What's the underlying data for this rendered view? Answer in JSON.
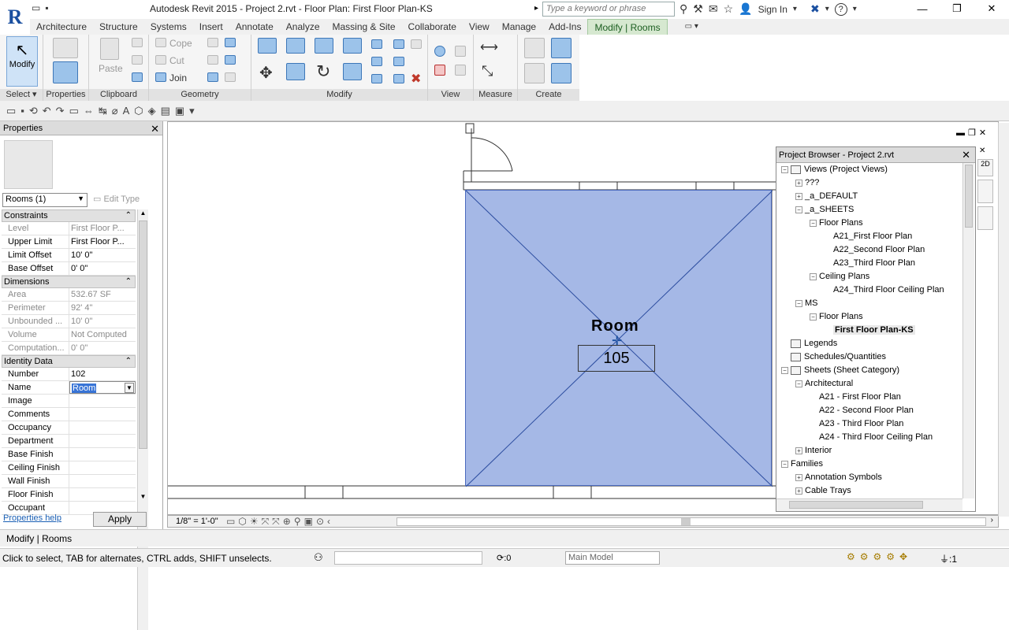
{
  "app": {
    "title": "Autodesk Revit 2015 -    Project 2.rvt - Floor Plan: First Floor Plan-KS",
    "logo_letter": "R",
    "search_placeholder": "Type a keyword or phrase",
    "sign_in": "Sign In"
  },
  "tabs": [
    {
      "label": "Architecture"
    },
    {
      "label": "Structure"
    },
    {
      "label": "Systems"
    },
    {
      "label": "Insert"
    },
    {
      "label": "Annotate"
    },
    {
      "label": "Analyze"
    },
    {
      "label": "Massing & Site"
    },
    {
      "label": "Collaborate"
    },
    {
      "label": "View"
    },
    {
      "label": "Manage"
    },
    {
      "label": "Add-Ins"
    },
    {
      "label": "Modify | Rooms"
    }
  ],
  "ribbon": {
    "modify_label": "Modify",
    "select_label": "Select",
    "properties_label": "Properties",
    "clipboard_label": "Clipboard",
    "paste_label": "Paste",
    "cope_label": "Cope",
    "cut_label": "Cut",
    "join_label": "Join",
    "geometry_label": "Geometry",
    "modify_panel_label": "Modify",
    "view_label": "View",
    "measure_label": "Measure",
    "create_label": "Create"
  },
  "properties": {
    "title": "Properties",
    "type_selector": "Rooms (1)",
    "edit_type": "Edit Type",
    "groups": [
      {
        "name": "Constraints",
        "rows": [
          {
            "k": "Level",
            "v": "First Floor P...",
            "disabled": true
          },
          {
            "k": "Upper Limit",
            "v": "First Floor P...",
            "disabled": false
          },
          {
            "k": "Limit Offset",
            "v": "10'  0\"",
            "disabled": false
          },
          {
            "k": "Base Offset",
            "v": "0'  0\"",
            "disabled": false
          }
        ]
      },
      {
        "name": "Dimensions",
        "rows": [
          {
            "k": "Area",
            "v": "532.67 SF",
            "disabled": true
          },
          {
            "k": "Perimeter",
            "v": "92'  4\"",
            "disabled": true
          },
          {
            "k": "Unbounded ...",
            "v": "10'  0\"",
            "disabled": true
          },
          {
            "k": "Volume",
            "v": "Not Computed",
            "disabled": true
          },
          {
            "k": "Computation...",
            "v": "0'  0\"",
            "disabled": true
          }
        ]
      },
      {
        "name": "Identity Data",
        "rows": [
          {
            "k": "Number",
            "v": "102",
            "disabled": false
          },
          {
            "k": "Name",
            "v": "Room",
            "disabled": false,
            "selected": true
          },
          {
            "k": "Image",
            "v": "",
            "disabled": false
          },
          {
            "k": "Comments",
            "v": "",
            "disabled": false
          },
          {
            "k": "Occupancy",
            "v": "",
            "disabled": false
          },
          {
            "k": "Department",
            "v": "",
            "disabled": false
          },
          {
            "k": "Base Finish",
            "v": "",
            "disabled": false
          },
          {
            "k": "Ceiling Finish",
            "v": "",
            "disabled": false
          },
          {
            "k": "Wall Finish",
            "v": "",
            "disabled": false
          },
          {
            "k": "Floor Finish",
            "v": "",
            "disabled": false
          },
          {
            "k": "Occupant",
            "v": "",
            "disabled": false
          }
        ]
      }
    ],
    "help_link": "Properties help",
    "apply_button": "Apply"
  },
  "canvas": {
    "room_label": "Room",
    "room_number": "105",
    "scale": "1/8\" = 1'-0\""
  },
  "project_browser": {
    "title": "Project Browser - Project 2.rvt",
    "items": [
      {
        "label": "Views (Project Views)",
        "level": 0,
        "exp": "−",
        "icon": true
      },
      {
        "label": "???",
        "level": 1,
        "exp": "+"
      },
      {
        "label": "_a_DEFAULT",
        "level": 1,
        "exp": "+"
      },
      {
        "label": "_a_SHEETS",
        "level": 1,
        "exp": "−"
      },
      {
        "label": "Floor Plans",
        "level": 2,
        "exp": "−"
      },
      {
        "label": "A21_First Floor Plan",
        "level": 3
      },
      {
        "label": "A22_Second Floor Plan",
        "level": 3
      },
      {
        "label": "A23_Third Floor Plan",
        "level": 3
      },
      {
        "label": "Ceiling Plans",
        "level": 2,
        "exp": "−"
      },
      {
        "label": "A24_Third Floor Ceiling Plan",
        "level": 3
      },
      {
        "label": "MS",
        "level": 1,
        "exp": "−"
      },
      {
        "label": "Floor Plans",
        "level": 2,
        "exp": "−"
      },
      {
        "label": "First Floor Plan-KS",
        "level": 3,
        "selected": true
      },
      {
        "label": "Legends",
        "level": 0,
        "icon": true
      },
      {
        "label": "Schedules/Quantities",
        "level": 0,
        "icon": true
      },
      {
        "label": "Sheets (Sheet Category)",
        "level": 0,
        "exp": "−",
        "icon": true
      },
      {
        "label": "Architectural",
        "level": 1,
        "exp": "−"
      },
      {
        "label": "A21 - First Floor Plan",
        "level": 2
      },
      {
        "label": "A22 - Second Floor Plan",
        "level": 2
      },
      {
        "label": "A23 - Third Floor Plan",
        "level": 2
      },
      {
        "label": "A24 - Third Floor Ceiling Plan",
        "level": 2
      },
      {
        "label": "Interior",
        "level": 1,
        "exp": "+"
      },
      {
        "label": "Families",
        "level": 0,
        "exp": "−"
      },
      {
        "label": "Annotation Symbols",
        "level": 1,
        "exp": "+"
      },
      {
        "label": "Cable Trays",
        "level": 1,
        "exp": "+"
      }
    ]
  },
  "status": {
    "context": "Modify | Rooms",
    "hint": "Click to select, TAB for alternates, CTRL adds, SHIFT unselects.",
    "zero": ":0",
    "main_model": "Main Model",
    "filter_count": ":1"
  },
  "colors": {
    "room_fill": "#a5b8e6",
    "active_tab": "#d6e8d0",
    "selection": "#3874d6"
  }
}
